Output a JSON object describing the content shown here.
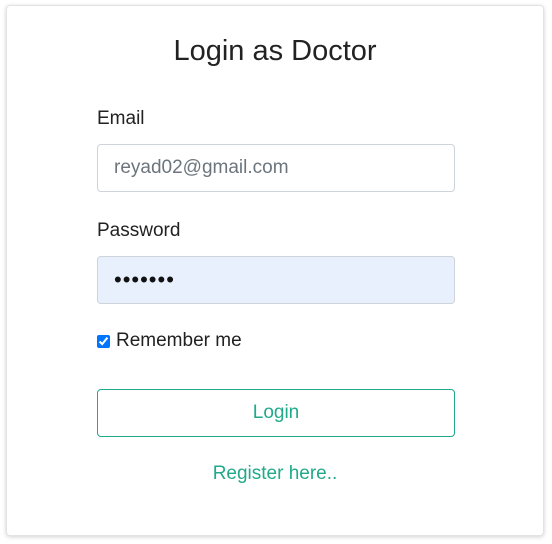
{
  "form": {
    "title": "Login as Doctor",
    "email_label": "Email",
    "email_placeholder": "reyad02@gmail.com",
    "email_value": "",
    "password_label": "Password",
    "password_value": "•••••••",
    "remember_label": "Remember me",
    "remember_checked": true,
    "login_label": "Login",
    "register_label": "Register here.."
  },
  "colors": {
    "accent": "#20a98b",
    "autofill_bg": "#e8f0fe",
    "text": "#222222"
  }
}
